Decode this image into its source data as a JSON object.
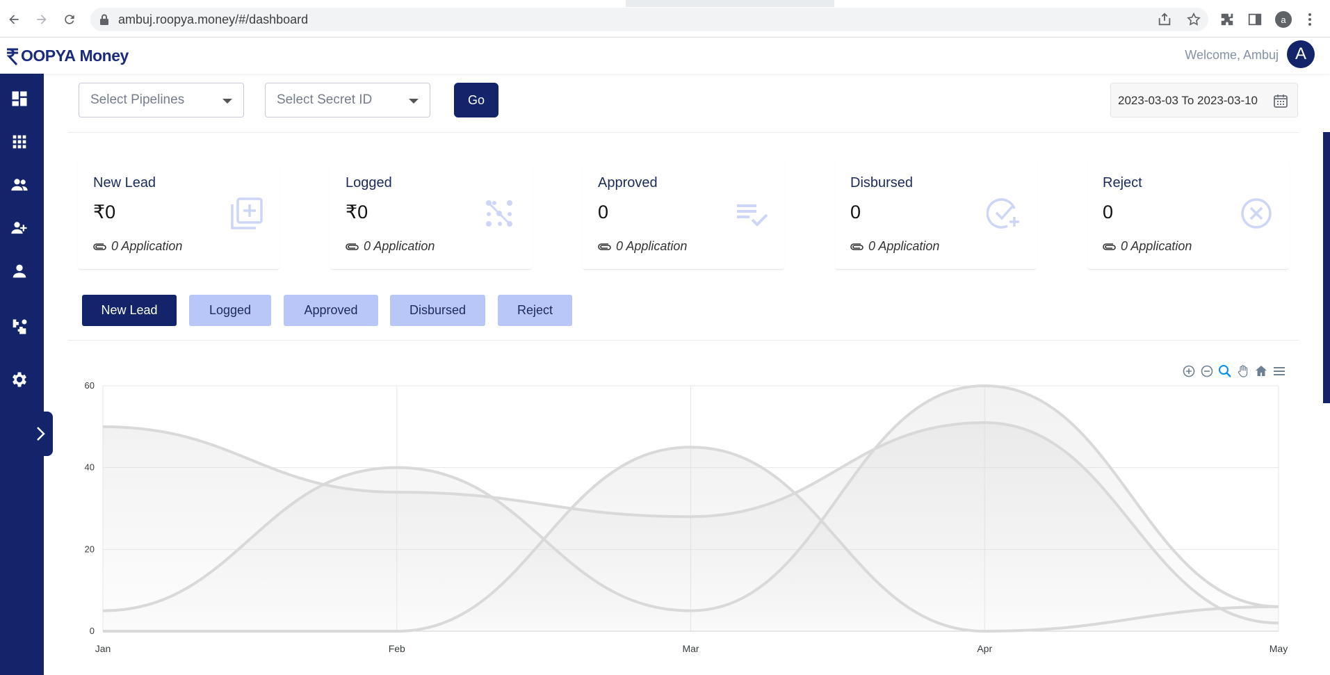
{
  "browser": {
    "url": "ambuj.roopya.money/#/dashboard",
    "profile_initial": "a"
  },
  "header": {
    "logo_text_1": "OOPYA",
    "logo_text_2": "Money",
    "welcome": "Welcome, Ambuj",
    "avatar_initial": "A"
  },
  "sidebar": {
    "items": [
      {
        "icon": "dashboard-icon"
      },
      {
        "icon": "apps-grid-icon"
      },
      {
        "icon": "group-icon"
      },
      {
        "icon": "add-user-icon"
      },
      {
        "icon": "person-icon"
      },
      {
        "icon": "integrations-icon"
      },
      {
        "icon": "settings-icon"
      }
    ]
  },
  "filters": {
    "pipelines_placeholder": "Select Pipelines",
    "secret_id_placeholder": "Select Secret ID",
    "go_label": "Go",
    "date_range": "2023-03-03 To 2023-03-10"
  },
  "stats": [
    {
      "title": "New Lead",
      "value": "₹0",
      "apps": "0 Application",
      "icon": "add-box-icon"
    },
    {
      "title": "Logged",
      "value": "₹0",
      "apps": "0 Application",
      "icon": "scatter-icon"
    },
    {
      "title": "Approved",
      "value": "0",
      "apps": "0 Application",
      "icon": "checklist-icon"
    },
    {
      "title": "Disbursed",
      "value": "0",
      "apps": "0 Application",
      "icon": "check-add-icon"
    },
    {
      "title": "Reject",
      "value": "0",
      "apps": "0 Application",
      "icon": "cancel-circle-icon"
    }
  ],
  "status_tabs": [
    {
      "label": "New Lead",
      "active": true
    },
    {
      "label": "Logged",
      "active": false
    },
    {
      "label": "Approved",
      "active": false
    },
    {
      "label": "Disbursed",
      "active": false
    },
    {
      "label": "Reject",
      "active": false
    }
  ],
  "chart_toolbar": [
    "zoom-in-icon",
    "zoom-out-icon",
    "zoom-select-icon",
    "pan-icon",
    "reset-home-icon",
    "menu-icon"
  ],
  "colors": {
    "primary": "#13246b",
    "tab_inactive": "#b8c7f7",
    "series_line": "#d9d9d9"
  },
  "chart_data": {
    "type": "area",
    "categories": [
      "Jan",
      "Feb",
      "Mar",
      "Apr",
      "May"
    ],
    "ylim": [
      0,
      60
    ],
    "yticks": [
      0,
      20,
      40,
      60
    ],
    "grid": true,
    "series": [
      {
        "values": [
          50,
          34,
          28,
          51,
          2
        ]
      },
      {
        "values": [
          5,
          40,
          5,
          60,
          6
        ]
      },
      {
        "values": [
          0,
          0,
          45,
          0,
          6
        ]
      }
    ]
  }
}
